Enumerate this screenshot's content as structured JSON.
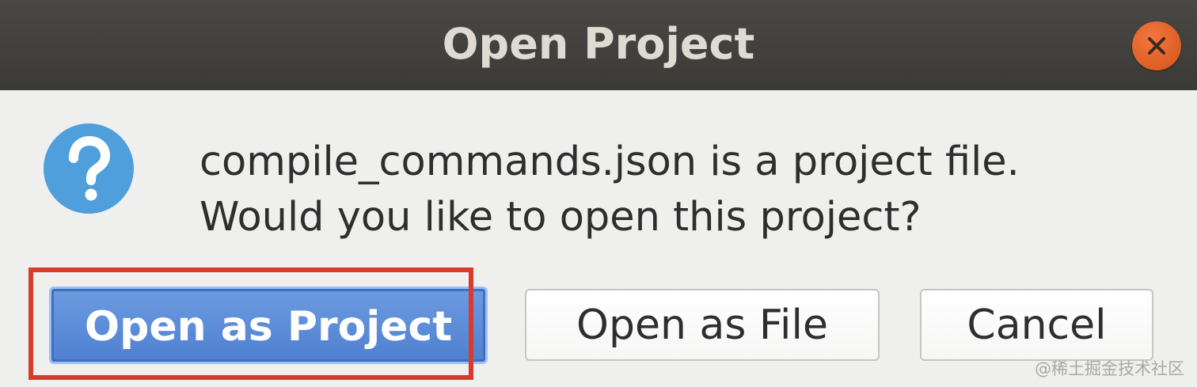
{
  "window": {
    "title": "Open Project",
    "close_icon": "close-icon",
    "close_color": "#e2612a"
  },
  "dialog": {
    "icon": "question-icon",
    "icon_color": "#4e9fdc",
    "message_line1": "compile_commands.json is a project file.",
    "message_line2": "Would you like to open this project?"
  },
  "buttons": {
    "open_as_project": "Open as Project",
    "open_as_file": "Open as File",
    "cancel": "Cancel"
  },
  "annotation": {
    "highlight_color": "#d93a2e"
  },
  "watermark": "@稀土掘金技术社区"
}
